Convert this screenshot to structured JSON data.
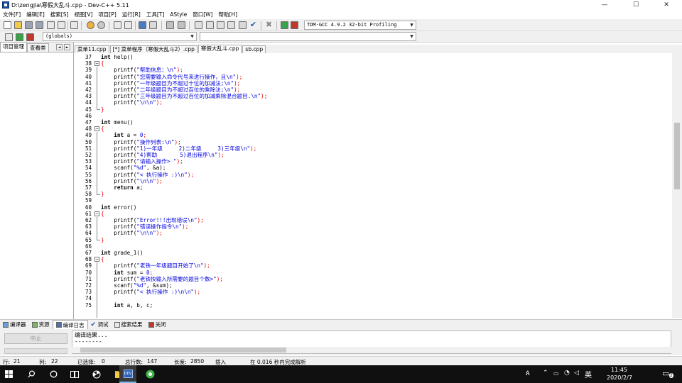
{
  "window": {
    "title": "D:\\zengjia\\寒假大乱斗.cpp - Dev-C++ 5.11",
    "controls": [
      "—",
      "☐",
      "✕"
    ]
  },
  "menu": [
    "文件[F]",
    "编辑[E]",
    "搜索[S]",
    "视图[V]",
    "项目[P]",
    "运行[R]",
    "工具[T]",
    "AStyle",
    "窗口[W]",
    "帮助[H]"
  ],
  "toolbar": {
    "compiler": "TDM-GCC 4.9.2 32-bit Profiling",
    "scope": "(globals)",
    "scope2": ""
  },
  "left_panel": {
    "tabs": [
      "项目管理",
      "查看类"
    ],
    "nav": [
      "◄",
      "►"
    ]
  },
  "file_tabs": [
    "菜单11.cpp",
    "[*] 菜单程序（寒假大乱斗2）.cpp",
    "寒假大乱斗.cpp",
    "sb.cpp"
  ],
  "code": {
    "line_numbers": [
      "37",
      "38",
      "39",
      "40",
      "41",
      "42",
      "43",
      "44",
      "45",
      "46",
      "47",
      "48",
      "49",
      "50",
      "51",
      "52",
      "53",
      "54",
      "55",
      "56",
      "57",
      "58",
      "59",
      "60",
      "61",
      "62",
      "63",
      "64",
      "65",
      "66",
      "67",
      "68",
      "69",
      "70",
      "71",
      "72",
      "73",
      "74",
      "75"
    ],
    "lines": [
      [
        {
          "t": "int",
          "c": "kw"
        },
        {
          "t": " help()",
          "c": ""
        }
      ],
      [
        {
          "t": "{",
          "c": "rd"
        }
      ],
      [
        {
          "t": "    printf(",
          "c": ""
        },
        {
          "t": "\"帮助信息：\\n\"",
          "c": "st"
        },
        {
          "t": ");",
          "c": "rd"
        }
      ],
      [
        {
          "t": "    printf(",
          "c": ""
        },
        {
          "t": "\"您需要输入命令代号来进行操作，且\\n\"",
          "c": "st"
        },
        {
          "t": ");",
          "c": "rd"
        }
      ],
      [
        {
          "t": "    printf(",
          "c": ""
        },
        {
          "t": "\"一年级题目为不超过十位的加减法;\\n\"",
          "c": "st"
        },
        {
          "t": ");",
          "c": "rd"
        }
      ],
      [
        {
          "t": "    printf(",
          "c": ""
        },
        {
          "t": "\"二年级题目为不超过百位的乘除法;\\n\"",
          "c": "st"
        },
        {
          "t": ");",
          "c": "rd"
        }
      ],
      [
        {
          "t": "    printf(",
          "c": ""
        },
        {
          "t": "\"三年级题目为不超过百位的加减乘除混合题目.\\n\"",
          "c": "st"
        },
        {
          "t": ");",
          "c": "rd"
        }
      ],
      [
        {
          "t": "    printf(",
          "c": ""
        },
        {
          "t": "\"\\n\\n\"",
          "c": "st"
        },
        {
          "t": ");",
          "c": "rd"
        }
      ],
      [
        {
          "t": "}",
          "c": "rd"
        }
      ],
      [],
      [
        {
          "t": "int",
          "c": "kw"
        },
        {
          "t": " menu()",
          "c": ""
        }
      ],
      [
        {
          "t": "{",
          "c": "rd"
        }
      ],
      [
        {
          "t": "    ",
          "c": ""
        },
        {
          "t": "int",
          "c": "kw"
        },
        {
          "t": " a = ",
          "c": ""
        },
        {
          "t": "0",
          "c": "st"
        },
        {
          "t": ";",
          "c": "rd"
        }
      ],
      [
        {
          "t": "    printf(",
          "c": ""
        },
        {
          "t": "\"操作列表:\\n\"",
          "c": "st"
        },
        {
          "t": ");",
          "c": "rd"
        }
      ],
      [
        {
          "t": "    printf(",
          "c": ""
        },
        {
          "t": "\"1)一年级     2)二年级     3)三年级\\n\"",
          "c": "st"
        },
        {
          "t": ");",
          "c": "rd"
        }
      ],
      [
        {
          "t": "    printf(",
          "c": ""
        },
        {
          "t": "\"4)帮助       5)退出程序\\n\"",
          "c": "st"
        },
        {
          "t": ");",
          "c": "rd"
        }
      ],
      [
        {
          "t": "    printf(",
          "c": ""
        },
        {
          "t": "\"请输入操作> \"",
          "c": "st"
        },
        {
          "t": ");",
          "c": "rd"
        }
      ],
      [
        {
          "t": "    scanf(",
          "c": ""
        },
        {
          "t": "\"%d\"",
          "c": "st"
        },
        {
          "t": ", &a);",
          "c": ""
        }
      ],
      [
        {
          "t": "    printf(",
          "c": ""
        },
        {
          "t": "\"< 执行操作 :)\\n\"",
          "c": "st"
        },
        {
          "t": ");",
          "c": "rd"
        }
      ],
      [
        {
          "t": "    printf(",
          "c": ""
        },
        {
          "t": "\"\\n\\n\"",
          "c": "st"
        },
        {
          "t": ");",
          "c": "rd"
        }
      ],
      [
        {
          "t": "    ",
          "c": ""
        },
        {
          "t": "return",
          "c": "kw"
        },
        {
          "t": " a;",
          "c": ""
        }
      ],
      [
        {
          "t": "}",
          "c": "rd"
        }
      ],
      [],
      [
        {
          "t": "int",
          "c": "kw"
        },
        {
          "t": " error()",
          "c": ""
        }
      ],
      [
        {
          "t": "{",
          "c": "rd"
        }
      ],
      [
        {
          "t": "    printf(",
          "c": ""
        },
        {
          "t": "\"Error!!!出现错误\\n\"",
          "c": "st"
        },
        {
          "t": ");",
          "c": "rd"
        }
      ],
      [
        {
          "t": "    printf(",
          "c": ""
        },
        {
          "t": "\"错误操作指令\\n\"",
          "c": "st"
        },
        {
          "t": ");",
          "c": "rd"
        }
      ],
      [
        {
          "t": "    printf(",
          "c": ""
        },
        {
          "t": "\"\\n\\n\"",
          "c": "st"
        },
        {
          "t": ");",
          "c": "rd"
        }
      ],
      [
        {
          "t": "}",
          "c": "rd"
        }
      ],
      [],
      [
        {
          "t": "int",
          "c": "kw"
        },
        {
          "t": " grade_1()",
          "c": ""
        }
      ],
      [
        {
          "t": "{",
          "c": "rd"
        }
      ],
      [
        {
          "t": "    printf(",
          "c": ""
        },
        {
          "t": "\"老铁一年级题目开始了\\n\"",
          "c": "st"
        },
        {
          "t": ");",
          "c": "rd"
        }
      ],
      [
        {
          "t": "    ",
          "c": ""
        },
        {
          "t": "int",
          "c": "kw"
        },
        {
          "t": " sum = ",
          "c": ""
        },
        {
          "t": "0",
          "c": "st"
        },
        {
          "t": ";",
          "c": "rd"
        }
      ],
      [
        {
          "t": "    printf(",
          "c": ""
        },
        {
          "t": "\"老铁快输入所需要的题目个数>\"",
          "c": "st"
        },
        {
          "t": ");",
          "c": "rd"
        }
      ],
      [
        {
          "t": "    scanf(",
          "c": ""
        },
        {
          "t": "\"%d\"",
          "c": "st"
        },
        {
          "t": ", &sum);",
          "c": ""
        }
      ],
      [
        {
          "t": "    printf(",
          "c": ""
        },
        {
          "t": "\"< 执行操作 :)\\n\\n\"",
          "c": "st"
        },
        {
          "t": ");",
          "c": "rd"
        }
      ],
      [],
      [
        {
          "t": "    ",
          "c": ""
        },
        {
          "t": "int",
          "c": "kw"
        },
        {
          "t": " a, b, c;",
          "c": ""
        }
      ]
    ]
  },
  "bottom_tabs": [
    "编译器",
    "资源",
    "编译日志",
    "调试",
    "搜索结果",
    "关闭"
  ],
  "bottom_panel": {
    "compile_button": "中止",
    "log_lines": [
      "编译结果...",
      "--------"
    ]
  },
  "status": {
    "row_label": "行:",
    "row": "21",
    "col_label": "列:",
    "col": "22",
    "sel_label": "已选择:",
    "sel": "0",
    "total_label": "总行数:",
    "total": "147",
    "len_label": "长度:",
    "len": "2850",
    "mode": "插入",
    "parse": "在 0.016 秒内完成解析"
  },
  "taskbar": {
    "time": "11:45",
    "date": "2020/2/7",
    "ime": "英",
    "notif_count": "2"
  },
  "colors": {
    "keyword": "#000000",
    "string": "#0000e0",
    "symbol": "#e00000",
    "taskbar": "#101010"
  }
}
